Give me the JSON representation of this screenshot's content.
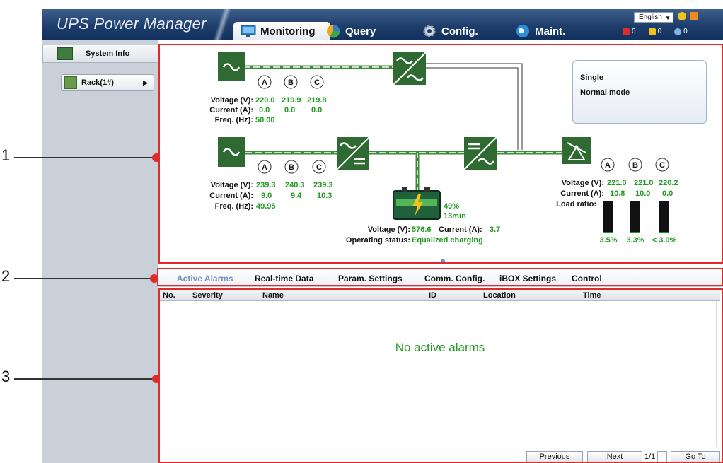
{
  "header": {
    "app_title": "UPS Power Manager",
    "tabs": [
      {
        "label": "Monitoring",
        "icon": "monitor-icon",
        "active": true
      },
      {
        "label": "Query",
        "icon": "pie-chart-icon",
        "active": false
      },
      {
        "label": "Config.",
        "icon": "gear-icon",
        "active": false
      },
      {
        "label": "Maint.",
        "icon": "globe-icon",
        "active": false
      }
    ],
    "language": "English",
    "alarm_counts": {
      "critical": "0",
      "major": "0",
      "minor": "0"
    }
  },
  "sidebar": {
    "system_info_label": "System Info",
    "rack_label": "Rack(1#)"
  },
  "callouts": [
    "1",
    "2",
    "3"
  ],
  "diagram": {
    "bypass_input": {
      "phases": [
        "A",
        "B",
        "C"
      ],
      "voltage_label": "Voltage (V):",
      "current_label": "Current (A):",
      "freq_label": "Freq. (Hz):",
      "voltage": [
        "220.0",
        "219.9",
        "219.8"
      ],
      "current": [
        "0.0",
        "0.0",
        "0.0"
      ],
      "freq": "50.00"
    },
    "main_input": {
      "phases": [
        "A",
        "B",
        "C"
      ],
      "voltage_label": "Voltage (V):",
      "current_label": "Current (A):",
      "freq_label": "Freq. (Hz):",
      "voltage": [
        "239.3",
        "240.3",
        "239.3"
      ],
      "current": [
        "9.0",
        "9.4",
        "10.3"
      ],
      "freq": "49.95"
    },
    "output": {
      "phases": [
        "A",
        "B",
        "C"
      ],
      "voltage_label": "Voltage (V):",
      "current_label": "Current (A):",
      "load_ratio_label": "Load ratio:",
      "voltage": [
        "221.0",
        "221.0",
        "220.2"
      ],
      "current": [
        "10.8",
        "10.0",
        "0.0"
      ],
      "load_ratio": [
        "3.5%",
        "3.3%",
        "< 3.0%"
      ],
      "load_fraction": [
        0.035,
        0.033,
        0.03
      ]
    },
    "battery": {
      "percent": "49%",
      "runtime": "13min",
      "voltage_label": "Voltage (V):",
      "voltage": "576.6",
      "current_label": "Current (A):",
      "current": "3.7",
      "status_label": "Operating status:",
      "status": "Equalized charging"
    },
    "status_box": {
      "line1": "Single",
      "line2": "Normal mode"
    }
  },
  "subtabs": [
    {
      "label": "Active Alarms",
      "active": true
    },
    {
      "label": "Real-time Data",
      "active": false
    },
    {
      "label": "Param. Settings",
      "active": false
    },
    {
      "label": "Comm. Config.",
      "active": false
    },
    {
      "label": "iBOX Settings",
      "active": false
    },
    {
      "label": "Control",
      "active": false
    }
  ],
  "alarm_table": {
    "columns": [
      "No.",
      "Severity",
      "Name",
      "ID",
      "Location",
      "Time"
    ],
    "empty_message": "No active alarms",
    "pager": {
      "previous": "Previous",
      "next": "Next",
      "page": "1/1",
      "goto": "Go To"
    }
  },
  "colors": {
    "accent_green": "#1f9a1f",
    "module_green": "#2f6a33",
    "header_blue": "#1d3d6b",
    "callout_red": "#e32a2a"
  }
}
